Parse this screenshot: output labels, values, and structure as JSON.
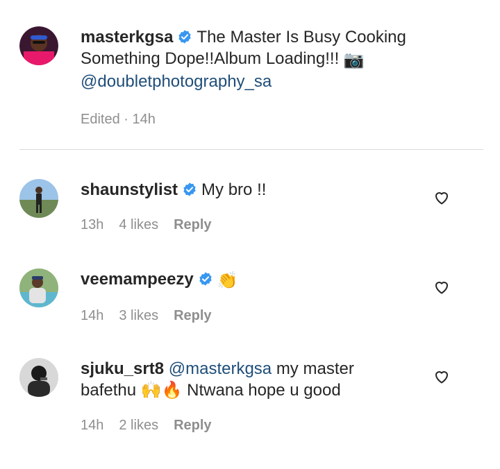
{
  "caption": {
    "username": "masterkgsa",
    "text_line1": "The Master Is Busy Cooking",
    "text_line2": "Something Dope!!Album Loading!!!",
    "camera_emoji": "📷",
    "mention": "@doubletphotography_sa",
    "edited_label": "Edited · 14h"
  },
  "comments": [
    {
      "username": "shaunstylist",
      "text": "My bro !!",
      "time": "13h",
      "likes": "4 likes",
      "reply": "Reply"
    },
    {
      "username": "veemampeezy",
      "text": "👏",
      "time": "14h",
      "likes": "3 likes",
      "reply": "Reply"
    },
    {
      "username": "sjuku_srt8",
      "mention": "@masterkgsa",
      "text_part1": "my master",
      "text_line2": "bafethu 🙌🔥 Ntwana hope u good",
      "time": "14h",
      "likes": "2 likes",
      "reply": "Reply"
    }
  ],
  "colors": {
    "verified_blue": "#3897f0",
    "mention_blue": "#1f4e79",
    "meta_gray": "#8e8e8e"
  }
}
